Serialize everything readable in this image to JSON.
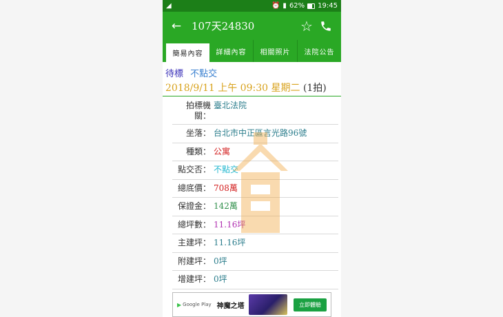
{
  "status_bar": {
    "signal_info": "62%",
    "time": "19:45"
  },
  "app_bar": {
    "title": "107天24830"
  },
  "tabs": [
    {
      "label": "簡易內容"
    },
    {
      "label": "詳細內容"
    },
    {
      "label": "相關照片"
    },
    {
      "label": "法院公告"
    }
  ],
  "listing": {
    "status_label": "待標",
    "status_value": "不點交",
    "date": "2018/9/11 上午 09:30 星期二",
    "auction_count": "(1拍)"
  },
  "details": {
    "agency_key": "拍標機關：",
    "agency_value": "臺北法院",
    "address_key": "坐落：",
    "address_value": "台北市中正區言光路96號",
    "type_key": "種類：",
    "type_value": "公寓",
    "handover_key": "點交否：",
    "handover_value": "不點交",
    "base_price_key": "總底價：",
    "base_price_value": "708萬",
    "deposit_key": "保證金：",
    "deposit_value": "142萬",
    "total_area_key": "總坪數：",
    "total_area_value": "11.16坪",
    "main_area_key": "主建坪：",
    "main_area_value": "11.16坪",
    "attached_area_key": "附建坪：",
    "attached_area_value": "0坪",
    "extra_area_key": "增建坪：",
    "extra_area_value": "0坪"
  },
  "ad": {
    "store": "Google Play",
    "game_name": "神魔之塔",
    "cta": "立即體驗"
  },
  "colors": {
    "app_green": "#2aa825",
    "status_green": "#1c7f18",
    "date_gold": "#d8a21c",
    "price_red": "#d21b1b"
  }
}
